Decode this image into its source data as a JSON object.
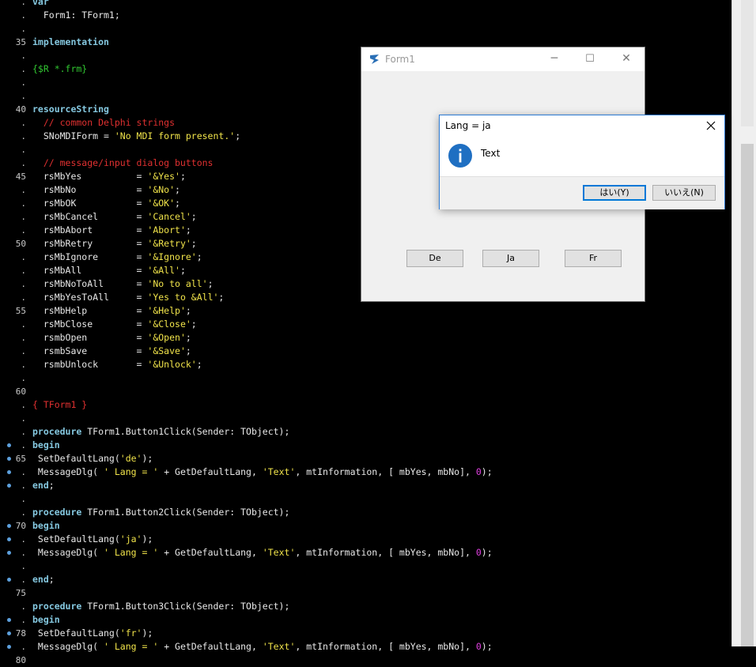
{
  "editor": {
    "lines": [
      {
        "g": ".",
        "bp": false,
        "tokens": [
          {
            "t": "kw",
            "s": "var"
          }
        ]
      },
      {
        "g": ".",
        "bp": false,
        "tokens": [
          {
            "t": "id",
            "s": "  Form1: TForm1;"
          }
        ]
      },
      {
        "g": ".",
        "bp": false,
        "tokens": []
      },
      {
        "g": "35",
        "bp": false,
        "tokens": [
          {
            "t": "kw",
            "s": "implementation"
          }
        ]
      },
      {
        "g": ".",
        "bp": false,
        "tokens": []
      },
      {
        "g": ".",
        "bp": false,
        "tokens": [
          {
            "t": "dir",
            "s": "{$R *.frm}"
          }
        ]
      },
      {
        "g": ".",
        "bp": false,
        "tokens": []
      },
      {
        "g": ".",
        "bp": false,
        "tokens": []
      },
      {
        "g": "40",
        "bp": false,
        "tokens": [
          {
            "t": "kw",
            "s": "resourceString"
          }
        ]
      },
      {
        "g": ".",
        "bp": false,
        "tokens": [
          {
            "t": "cmt",
            "s": "  // common Delphi strings"
          }
        ]
      },
      {
        "g": ".",
        "bp": false,
        "tokens": [
          {
            "t": "id",
            "s": "  SNoMDIForm = "
          },
          {
            "t": "str",
            "s": "'No MDI form present.'"
          },
          {
            "t": "id",
            "s": ";"
          }
        ]
      },
      {
        "g": ".",
        "bp": false,
        "tokens": []
      },
      {
        "g": ".",
        "bp": false,
        "tokens": [
          {
            "t": "cmt",
            "s": "  // message/input dialog buttons"
          }
        ]
      },
      {
        "g": "45",
        "bp": false,
        "tokens": [
          {
            "t": "id",
            "s": "  rsMbYes          = "
          },
          {
            "t": "str",
            "s": "'&Yes'"
          },
          {
            "t": "id",
            "s": ";"
          }
        ]
      },
      {
        "g": ".",
        "bp": false,
        "tokens": [
          {
            "t": "id",
            "s": "  rsMbNo           = "
          },
          {
            "t": "str",
            "s": "'&No'"
          },
          {
            "t": "id",
            "s": ";"
          }
        ]
      },
      {
        "g": ".",
        "bp": false,
        "tokens": [
          {
            "t": "id",
            "s": "  rsMbOK           = "
          },
          {
            "t": "str",
            "s": "'&OK'"
          },
          {
            "t": "id",
            "s": ";"
          }
        ]
      },
      {
        "g": ".",
        "bp": false,
        "tokens": [
          {
            "t": "id",
            "s": "  rsMbCancel       = "
          },
          {
            "t": "str",
            "s": "'Cancel'"
          },
          {
            "t": "id",
            "s": ";"
          }
        ]
      },
      {
        "g": ".",
        "bp": false,
        "tokens": [
          {
            "t": "id",
            "s": "  rsMbAbort        = "
          },
          {
            "t": "str",
            "s": "'Abort'"
          },
          {
            "t": "id",
            "s": ";"
          }
        ]
      },
      {
        "g": "50",
        "bp": false,
        "tokens": [
          {
            "t": "id",
            "s": "  rsMbRetry        = "
          },
          {
            "t": "str",
            "s": "'&Retry'"
          },
          {
            "t": "id",
            "s": ";"
          }
        ]
      },
      {
        "g": ".",
        "bp": false,
        "tokens": [
          {
            "t": "id",
            "s": "  rsMbIgnore       = "
          },
          {
            "t": "str",
            "s": "'&Ignore'"
          },
          {
            "t": "id",
            "s": ";"
          }
        ]
      },
      {
        "g": ".",
        "bp": false,
        "tokens": [
          {
            "t": "id",
            "s": "  rsMbAll          = "
          },
          {
            "t": "str",
            "s": "'&All'"
          },
          {
            "t": "id",
            "s": ";"
          }
        ]
      },
      {
        "g": ".",
        "bp": false,
        "tokens": [
          {
            "t": "id",
            "s": "  rsMbNoToAll      = "
          },
          {
            "t": "str",
            "s": "'No to all'"
          },
          {
            "t": "id",
            "s": ";"
          }
        ]
      },
      {
        "g": ".",
        "bp": false,
        "tokens": [
          {
            "t": "id",
            "s": "  rsMbYesToAll     = "
          },
          {
            "t": "str",
            "s": "'Yes to &All'"
          },
          {
            "t": "id",
            "s": ";"
          }
        ]
      },
      {
        "g": "55",
        "bp": false,
        "tokens": [
          {
            "t": "id",
            "s": "  rsMbHelp         = "
          },
          {
            "t": "str",
            "s": "'&Help'"
          },
          {
            "t": "id",
            "s": ";"
          }
        ]
      },
      {
        "g": ".",
        "bp": false,
        "tokens": [
          {
            "t": "id",
            "s": "  rsMbClose        = "
          },
          {
            "t": "str",
            "s": "'&Close'"
          },
          {
            "t": "id",
            "s": ";"
          }
        ]
      },
      {
        "g": ".",
        "bp": false,
        "tokens": [
          {
            "t": "id",
            "s": "  rsmbOpen         = "
          },
          {
            "t": "str",
            "s": "'&Open'"
          },
          {
            "t": "id",
            "s": ";"
          }
        ]
      },
      {
        "g": ".",
        "bp": false,
        "tokens": [
          {
            "t": "id",
            "s": "  rsmbSave         = "
          },
          {
            "t": "str",
            "s": "'&Save'"
          },
          {
            "t": "id",
            "s": ";"
          }
        ]
      },
      {
        "g": ".",
        "bp": false,
        "tokens": [
          {
            "t": "id",
            "s": "  rsmbUnlock       = "
          },
          {
            "t": "str",
            "s": "'&Unlock'"
          },
          {
            "t": "id",
            "s": ";"
          }
        ]
      },
      {
        "g": ".",
        "bp": false,
        "tokens": []
      },
      {
        "g": "60",
        "bp": false,
        "tokens": []
      },
      {
        "g": ".",
        "bp": false,
        "tokens": [
          {
            "t": "cmt",
            "s": "{ TForm1 }"
          }
        ]
      },
      {
        "g": ".",
        "bp": false,
        "tokens": []
      },
      {
        "g": ".",
        "bp": false,
        "tokens": [
          {
            "t": "kw",
            "s": "procedure"
          },
          {
            "t": "id",
            "s": " TForm1.Button1Click(Sender: TObject);"
          }
        ]
      },
      {
        "g": ".",
        "bp": true,
        "tokens": [
          {
            "t": "kw",
            "s": "begin"
          }
        ]
      },
      {
        "g": "65",
        "bp": true,
        "tokens": [
          {
            "t": "id",
            "s": " SetDefaultLang("
          },
          {
            "t": "str",
            "s": "'de'"
          },
          {
            "t": "id",
            "s": ");"
          }
        ]
      },
      {
        "g": ".",
        "bp": true,
        "tokens": [
          {
            "t": "id",
            "s": " MessageDlg( "
          },
          {
            "t": "str",
            "s": "' Lang = '"
          },
          {
            "t": "id",
            "s": " + GetDefaultLang, "
          },
          {
            "t": "str",
            "s": "'Text'"
          },
          {
            "t": "id",
            "s": ", mtInformation, [ mbYes, mbNo], "
          },
          {
            "t": "num",
            "s": "0"
          },
          {
            "t": "id",
            "s": ");"
          }
        ]
      },
      {
        "g": ".",
        "bp": true,
        "tokens": [
          {
            "t": "kw",
            "s": "end"
          },
          {
            "t": "id",
            "s": ";"
          }
        ]
      },
      {
        "g": ".",
        "bp": false,
        "tokens": []
      },
      {
        "g": ".",
        "bp": false,
        "tokens": [
          {
            "t": "kw",
            "s": "procedure"
          },
          {
            "t": "id",
            "s": " TForm1.Button2Click(Sender: TObject);"
          }
        ]
      },
      {
        "g": "70",
        "bp": true,
        "tokens": [
          {
            "t": "kw",
            "s": "begin"
          }
        ]
      },
      {
        "g": ".",
        "bp": true,
        "tokens": [
          {
            "t": "id",
            "s": " SetDefaultLang("
          },
          {
            "t": "str",
            "s": "'ja'"
          },
          {
            "t": "id",
            "s": ");"
          }
        ]
      },
      {
        "g": ".",
        "bp": true,
        "tokens": [
          {
            "t": "id",
            "s": " MessageDlg( "
          },
          {
            "t": "str",
            "s": "' Lang = '"
          },
          {
            "t": "id",
            "s": " + GetDefaultLang, "
          },
          {
            "t": "str",
            "s": "'Text'"
          },
          {
            "t": "id",
            "s": ", mtInformation, [ mbYes, mbNo], "
          },
          {
            "t": "num",
            "s": "0"
          },
          {
            "t": "id",
            "s": ");"
          }
        ]
      },
      {
        "g": ".",
        "bp": false,
        "tokens": []
      },
      {
        "g": ".",
        "bp": true,
        "tokens": [
          {
            "t": "kw",
            "s": "end"
          },
          {
            "t": "id",
            "s": ";"
          }
        ]
      },
      {
        "g": "75",
        "bp": false,
        "tokens": []
      },
      {
        "g": ".",
        "bp": false,
        "tokens": [
          {
            "t": "kw",
            "s": "procedure"
          },
          {
            "t": "id",
            "s": " TForm1.Button3Click(Sender: TObject);"
          }
        ]
      },
      {
        "g": ".",
        "bp": true,
        "tokens": [
          {
            "t": "kw",
            "s": "begin"
          }
        ]
      },
      {
        "g": "78",
        "bp": true,
        "tokens": [
          {
            "t": "id",
            "s": " SetDefaultLang("
          },
          {
            "t": "str",
            "s": "'fr'"
          },
          {
            "t": "id",
            "s": ");"
          }
        ]
      },
      {
        "g": ".",
        "bp": true,
        "tokens": [
          {
            "t": "id",
            "s": " MessageDlg( "
          },
          {
            "t": "str",
            "s": "' Lang = '"
          },
          {
            "t": "id",
            "s": " + GetDefaultLang, "
          },
          {
            "t": "str",
            "s": "'Text'"
          },
          {
            "t": "id",
            "s": ", mtInformation, [ mbYes, mbNo], "
          },
          {
            "t": "num",
            "s": "0"
          },
          {
            "t": "id",
            "s": ");"
          }
        ]
      },
      {
        "g": "80",
        "bp": false,
        "tokens": []
      }
    ]
  },
  "form1": {
    "title": "Form1",
    "minimize": "─",
    "maximize": "☐",
    "close": "✕",
    "buttons": {
      "de": "De",
      "ja": "Ja",
      "fr": "Fr"
    }
  },
  "dialog": {
    "title": "Lang = ja",
    "text": "Text",
    "icon": "information-icon",
    "icon_glyph": "i",
    "yes_label": "はい(Y)",
    "no_label": "いいえ(N)"
  },
  "colors": {
    "keyword": "#85c8e0",
    "string": "#f0e34a",
    "comment": "#e03030",
    "directive": "#31c631",
    "number": "#e040e0",
    "breakpoint": "#5da0dd",
    "accent": "#0078d7"
  }
}
